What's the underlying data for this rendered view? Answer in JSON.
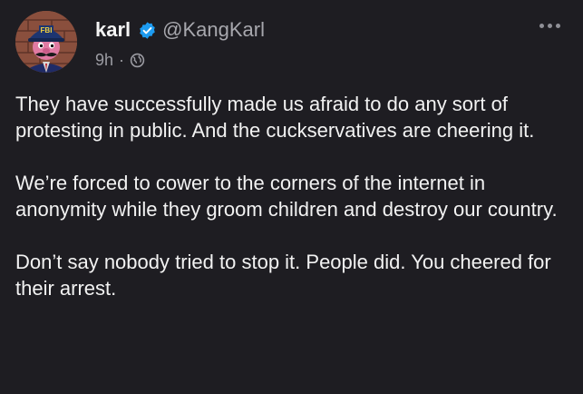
{
  "post": {
    "author": {
      "display_name": "karl",
      "handle": "@KangKarl",
      "verified": true,
      "avatar_badge_text": "FBI"
    },
    "timestamp": "9h",
    "meta_separator": "·",
    "visibility_icon": "globe-icon",
    "menu_icon": "more-horizontal-icon",
    "paragraphs": [
      "They have successfully made us afraid to do any sort of protesting in public. And the cuckservatives are cheering it.",
      "We’re forced to cower to the corners of the internet in anonymity while they groom children and destroy our country.",
      "Don’t say nobody tried to stop it. People did. You cheered for their arrest."
    ]
  },
  "colors": {
    "background": "#1e1d22",
    "text": "#f2f2f2",
    "secondary_text": "#a7a7ad",
    "verified_blue": "#1d9bf0"
  }
}
